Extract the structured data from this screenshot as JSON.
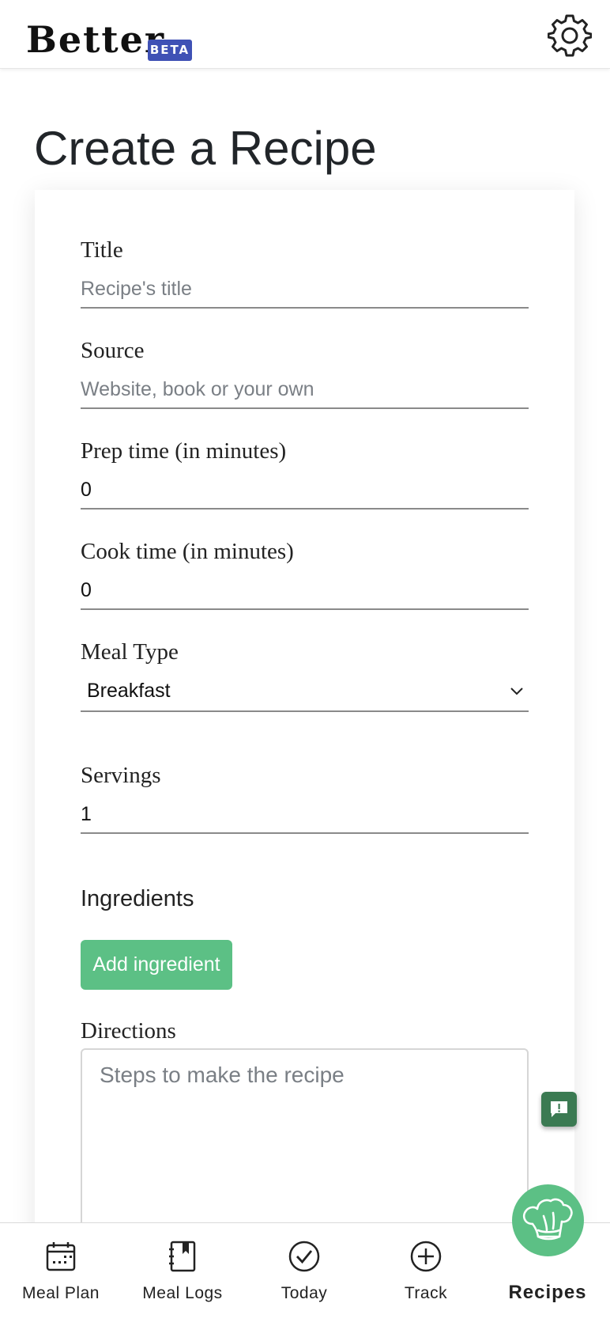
{
  "header": {
    "brand": "Better",
    "badge": "BETA",
    "settings_icon": "gear-icon"
  },
  "page": {
    "title": "Create a Recipe"
  },
  "form": {
    "title": {
      "label": "Title",
      "placeholder": "Recipe's title",
      "value": ""
    },
    "source": {
      "label": "Source",
      "placeholder": "Website, book or your own",
      "value": ""
    },
    "prep_time": {
      "label": "Prep time (in minutes)",
      "value": "0"
    },
    "cook_time": {
      "label": "Cook time (in minutes)",
      "value": "0"
    },
    "meal_type": {
      "label": "Meal Type",
      "selected": "Breakfast"
    },
    "servings": {
      "label": "Servings",
      "value": "1"
    },
    "ingredients": {
      "heading": "Ingredients",
      "add_button": "Add ingredient"
    },
    "directions": {
      "label": "Directions",
      "placeholder": "Steps to make the recipe"
    }
  },
  "bottom_nav": {
    "items": [
      {
        "label": "Meal Plan",
        "icon": "calendar-icon",
        "active": false
      },
      {
        "label": "Meal Logs",
        "icon": "log-book-icon",
        "active": false
      },
      {
        "label": "Today",
        "icon": "check-circle-icon",
        "active": false
      },
      {
        "label": "Track",
        "icon": "plus-circle-icon",
        "active": false
      },
      {
        "label": "Recipes",
        "icon": "chef-hat-icon",
        "active": true
      }
    ]
  },
  "floating": {
    "feedback_icon": "feedback-icon",
    "chef_icon": "chef-hat-icon"
  },
  "colors": {
    "accent_green": "#5cc085",
    "feedback_green": "#3b7a52",
    "beta_blue": "#3f51b5"
  }
}
